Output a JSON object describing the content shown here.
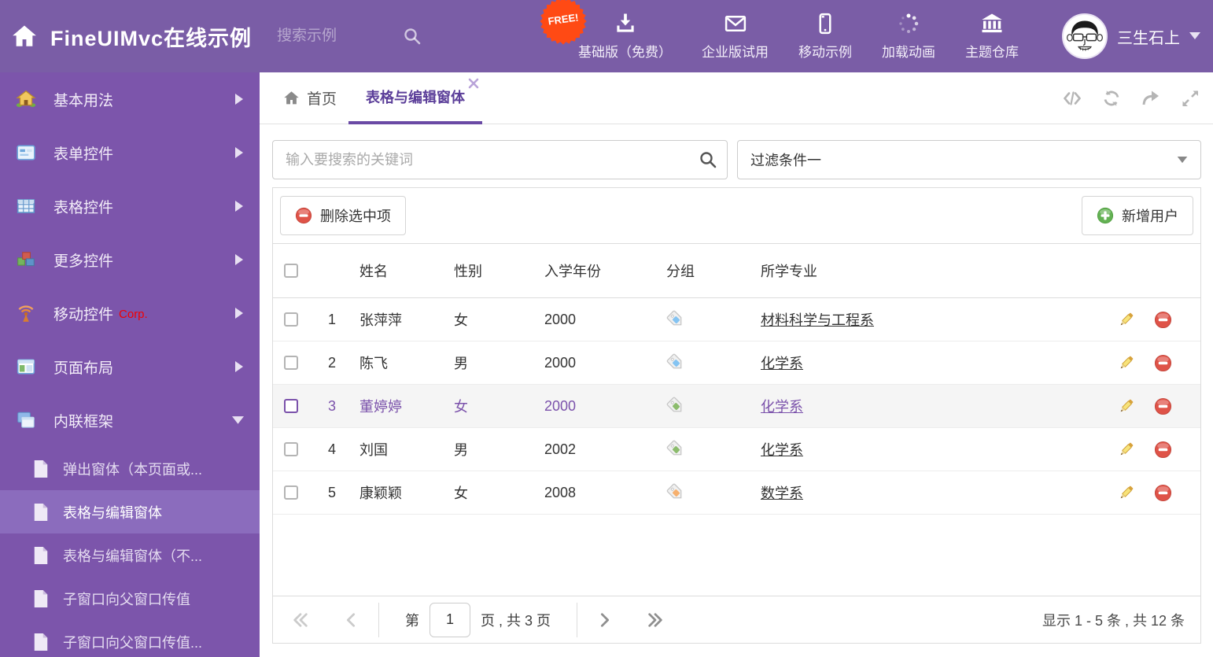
{
  "header": {
    "app_title": "FineUIMvc在线示例",
    "search_placeholder": "搜索示例",
    "free_badge": "FREE!",
    "nav": [
      {
        "label": "基础版（免费）",
        "icon": "download-icon"
      },
      {
        "label": "企业版试用",
        "icon": "envelope-icon"
      },
      {
        "label": "移动示例",
        "icon": "phone-icon"
      },
      {
        "label": "加载动画",
        "icon": "spinner-icon"
      },
      {
        "label": "主题仓库",
        "icon": "bank-icon"
      }
    ],
    "user_name": "三生石上"
  },
  "sidebar": {
    "items": [
      {
        "label": "基本用法",
        "icon": "house-icon"
      },
      {
        "label": "表单控件",
        "icon": "form-icon"
      },
      {
        "label": "表格控件",
        "icon": "grid-icon"
      },
      {
        "label": "更多控件",
        "icon": "cubes-icon"
      },
      {
        "label": "移动控件",
        "badge": "Corp.",
        "icon": "wireless-icon"
      },
      {
        "label": "页面布局",
        "icon": "layout-icon"
      },
      {
        "label": "内联框架",
        "icon": "frames-icon",
        "expanded": true
      }
    ],
    "subitems": [
      {
        "label": "弹出窗体（本页面或..."
      },
      {
        "label": "表格与编辑窗体",
        "active": true
      },
      {
        "label": "表格与编辑窗体（不..."
      },
      {
        "label": "子窗口向父窗口传值"
      },
      {
        "label": "子窗口向父窗口传值..."
      }
    ]
  },
  "tabs": {
    "home": "首页",
    "active": "表格与编辑窗体",
    "tools": [
      "code-icon",
      "refresh-icon",
      "share-icon",
      "expand-icon"
    ]
  },
  "filters": {
    "keyword_placeholder": "输入要搜索的关键词",
    "filter_selected": "过滤条件一"
  },
  "toolbar": {
    "delete_label": "删除选中项",
    "add_label": "新增用户"
  },
  "table": {
    "columns": {
      "name": "姓名",
      "gender": "性别",
      "year": "入学年份",
      "group": "分组",
      "major": "所学专业"
    },
    "rows": [
      {
        "num": "1",
        "name": "张萍萍",
        "gender": "女",
        "year": "2000",
        "tag": "blue",
        "major": "材料科学与工程系",
        "selected": false
      },
      {
        "num": "2",
        "name": "陈飞",
        "gender": "男",
        "year": "2000",
        "tag": "blue",
        "major": "化学系",
        "selected": false
      },
      {
        "num": "3",
        "name": "董婷婷",
        "gender": "女",
        "year": "2000",
        "tag": "green",
        "major": "化学系",
        "selected": true
      },
      {
        "num": "4",
        "name": "刘国",
        "gender": "男",
        "year": "2002",
        "tag": "green",
        "major": "化学系",
        "selected": false
      },
      {
        "num": "5",
        "name": "康颖颖",
        "gender": "女",
        "year": "2008",
        "tag": "orange",
        "major": "数学系",
        "selected": false
      }
    ]
  },
  "pagination": {
    "label_prefix": "第",
    "current_page": "1",
    "label_suffix": "页 , 共 3 页",
    "summary": "显示 1 - 5 条 , 共 12 条"
  },
  "colors": {
    "header_bg": "#7a5da6",
    "sidebar_bg": "#7c55ab",
    "sidebar_active_bg": "#8b6cbd",
    "accent_purple": "#6a4aa5",
    "selected_row_text": "#7b52ab",
    "free_badge": "#ff4a14",
    "corp_red": "#f20000",
    "tag_blue": "#85c4f2",
    "tag_green": "#8cbc6d",
    "tag_orange": "#f6b06e",
    "delete_red": "#df5348",
    "add_green": "#63b153"
  }
}
